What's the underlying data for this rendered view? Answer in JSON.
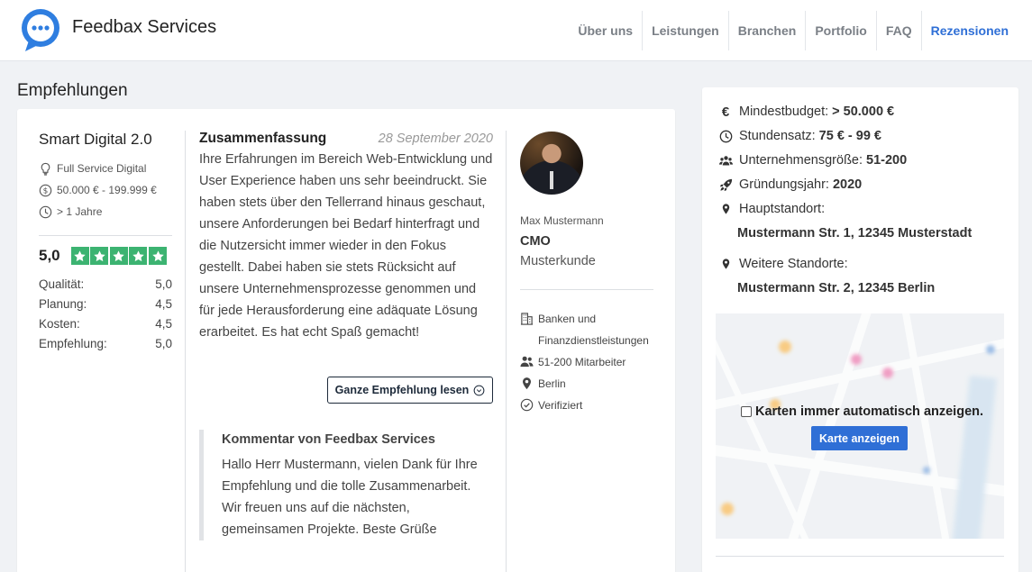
{
  "header": {
    "brand": "Feedbax Services",
    "nav": [
      {
        "label": "Über uns",
        "active": false
      },
      {
        "label": "Leistungen",
        "active": false
      },
      {
        "label": "Branchen",
        "active": false
      },
      {
        "label": "Portfolio",
        "active": false
      },
      {
        "label": "FAQ",
        "active": false
      },
      {
        "label": "Rezensionen",
        "active": true
      }
    ]
  },
  "section_title": "Empfehlungen",
  "review": {
    "company": "Smart Digital 2.0",
    "service": "Full Service Digital",
    "budget": "50.000 € - 199.999 €",
    "duration": "> 1 Jahre",
    "rating": "5,0",
    "stars": 5,
    "scores": [
      {
        "label": "Qualität:",
        "value": "5,0"
      },
      {
        "label": "Planung:",
        "value": "4,5"
      },
      {
        "label": "Kosten:",
        "value": "4,5"
      },
      {
        "label": "Empfehlung:",
        "value": "5,0"
      }
    ],
    "summary_title": "Zusammenfassung",
    "date": "28 September 2020",
    "text": "Ihre Erfahrungen im Bereich Web-Entwicklung und User Experience haben uns sehr beeindruckt. Sie haben stets über den Tellerrand hinaus geschaut, unsere Anforderungen bei Bedarf hinterfragt und die Nutzersicht immer wieder in den Fokus gestellt. Dabei haben sie stets Rücksicht auf unsere Unternehmensprozesse genommen und für jede Herausforderung eine adäquate Lösung erarbeitet. Es hat echt Spaß gemacht!",
    "read_more": "Ganze Empfehlung lesen",
    "comment_title": "Kommentar von Feedbax Services",
    "comment_text": "Hallo Herr Mustermann, vielen Dank für Ihre Empfehlung und die tolle Zusammenarbeit. Wir freuen uns auf die nächsten, gemeinsamen Projekte. Beste Grüße",
    "reviewer": {
      "name": "Max Mustermann",
      "role": "CMO",
      "company": "Musterkunde",
      "industry": "Banken und Finanzdienstleistungen",
      "employees": "51-200 Mitarbeiter",
      "location": "Berlin",
      "verified": "Verifiziert"
    }
  },
  "sidebar": {
    "min_budget_label": "Mindestbudget:",
    "min_budget": "> 50.000 €",
    "hourly_label": "Stundensatz:",
    "hourly": "75 € - 99 €",
    "size_label": "Unternehmensgröße:",
    "size": "51-200",
    "founded_label": "Gründungsjahr:",
    "founded": "2020",
    "hq_label": "Hauptstandort:",
    "hq": "Mustermann Str. 1, 12345 Musterstadt",
    "other_label": "Weitere Standorte:",
    "other": "Mustermann Str. 2, 12345 Berlin",
    "map_checkbox": "Karten immer automatisch anzeigen.",
    "map_button": "Karte anzeigen"
  },
  "colors": {
    "accent": "#2f6fd6",
    "star_green": "#3cb371"
  }
}
